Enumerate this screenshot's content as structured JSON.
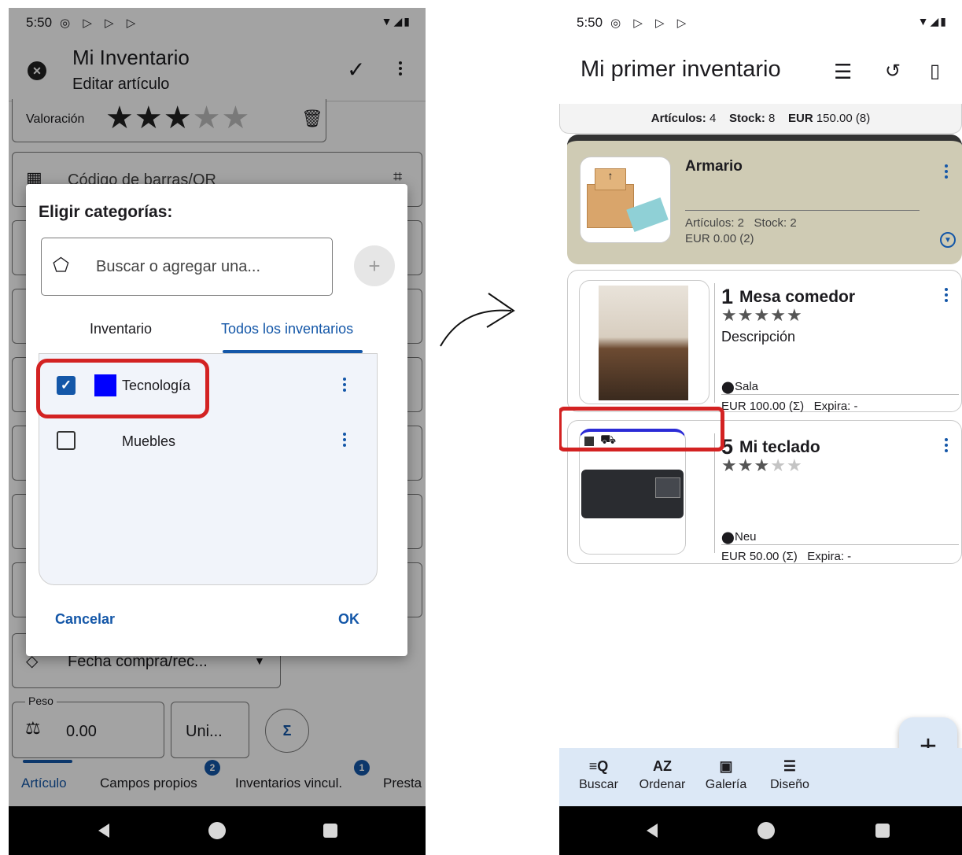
{
  "left_screen": {
    "status": {
      "time": "5:50"
    },
    "appbar": {
      "title": "Mi Inventario",
      "subtitle": "Editar artículo"
    },
    "rating": {
      "label": "Valoración",
      "value": 3,
      "max": 5
    },
    "barcode_field": {
      "placeholder": "Código de barras/QR"
    },
    "purchase_date_field": {
      "value": "Fecha compra/rec..."
    },
    "weight_field": {
      "label": "Peso",
      "value": "0.00"
    },
    "unit_field": {
      "value": "Uni..."
    },
    "sum_button": {
      "label": "Σ"
    },
    "tabs": [
      {
        "label": "Artículo",
        "badge": ""
      },
      {
        "label": "Campos propios",
        "badge": "2"
      },
      {
        "label": "Inventarios vincul.",
        "badge": "1"
      },
      {
        "label": "Presta",
        "badge": ""
      }
    ],
    "dialog": {
      "title": "Eligir categorías:",
      "search_placeholder": "Buscar o agregar una...",
      "add_label": "+",
      "tabs": [
        {
          "label": "Inventario"
        },
        {
          "label": "Todos los inventarios"
        }
      ],
      "categories": [
        {
          "name": "Tecnología",
          "checked": true,
          "color": "#0000ff"
        },
        {
          "name": "Muebles",
          "checked": false,
          "color": ""
        }
      ],
      "cancel_label": "Cancelar",
      "ok_label": "OK"
    }
  },
  "arrow": {
    "icon": "curved-arrow-icon"
  },
  "right_screen": {
    "status": {
      "time": "5:50"
    },
    "appbar": {
      "title": "Mi primer inventario"
    },
    "summary": {
      "articles_label": "Artículos:",
      "articles_value": "4",
      "stock_label": "Stock:",
      "stock_value": "8",
      "currency": "EUR",
      "amount": "150.00 (8)"
    },
    "folder": {
      "name": "Armario",
      "articles_line": "Artículos: 2   Stock: 2",
      "value_line": "EUR 0.00 (2)"
    },
    "items": [
      {
        "qty": "1",
        "name": "Mesa comedor",
        "stars": 5,
        "description": "Descripción",
        "location": "Sala",
        "price_line": "EUR 100.00 (Σ)   Expira: -"
      },
      {
        "qty": "5",
        "name": "Mi teclado",
        "stars": 3,
        "description": "",
        "location": "Neu",
        "price_line": "EUR 50.00 (Σ)   Expira: -"
      }
    ],
    "fab": {
      "label": "+"
    },
    "bottom_nav": [
      {
        "label": "Buscar",
        "icon": "≡Q"
      },
      {
        "label": "Ordenar",
        "icon": "AZ"
      },
      {
        "label": "Galería",
        "icon": "▣"
      },
      {
        "label": "Diseño",
        "icon": "☰"
      }
    ],
    "colors": {
      "accent": "#2b2bd6",
      "folder_bg": "#cfcbb4",
      "nav_bg": "#dce8f6"
    }
  }
}
